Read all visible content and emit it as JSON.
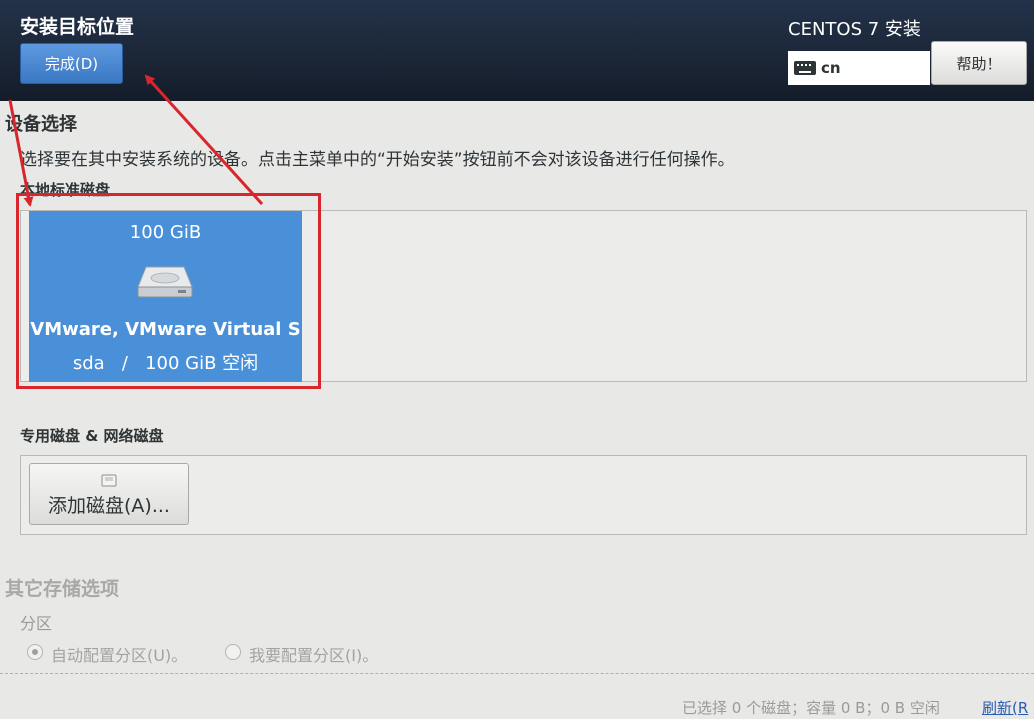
{
  "header": {
    "spoke_title": "安装目标位置",
    "done_label": "完成(D)",
    "product_title": "CENTOS 7 安装",
    "keyboard_layout": "cn",
    "help_label": "帮助！"
  },
  "device_selection": {
    "title": "设备选择",
    "instructions": "选择要在其中安装系统的设备。点击主菜单中的“开始安装”按钮前不会对该设备进行任何操作。",
    "local_disks_label": "本地标准磁盘",
    "disks": [
      {
        "size": "100 GiB",
        "name": "VMware, VMware Virtual S",
        "device": "sda",
        "separator": "/",
        "free": "100 GiB 空闲",
        "selected": true,
        "icon": "hard-drive-icon"
      }
    ],
    "special_disks_label": "专用磁盘 & 网络磁盘",
    "add_disk_label": "添加磁盘(A)..."
  },
  "other_storage": {
    "title": "其它存储选项",
    "partitioning_label": "分区",
    "options": [
      {
        "label": "自动配置分区(U)。",
        "checked": true
      },
      {
        "label": "我要配置分区(I)。",
        "checked": false
      }
    ]
  },
  "footer": {
    "status": "已选择 0 个磁盘；容量 0 B；0 B 空闲",
    "refresh_label": "刷新(R"
  },
  "annotations": {
    "highlight_color": "#d9262c",
    "arrow_color": "#d9262c"
  },
  "colors": {
    "accent": "#4a90d9",
    "header_bg": "#1c2738"
  }
}
